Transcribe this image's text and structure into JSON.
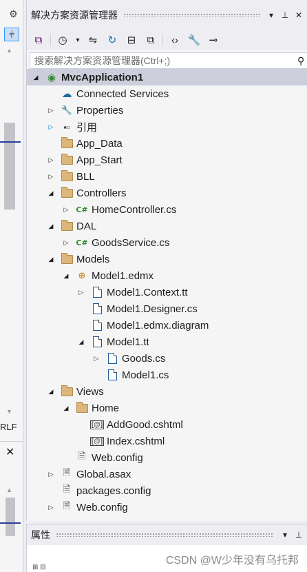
{
  "left_strip": {
    "gear_icon": "gear-icon",
    "pin_glyph": "⫩",
    "status_text": "RLF",
    "close_glyph": "✕"
  },
  "solution_explorer": {
    "title": "解决方案资源管理器",
    "title_buttons": [
      "▾",
      "📌",
      "✕"
    ],
    "toolbar": [
      {
        "name": "vs-switch-icon",
        "glyph": "⧉"
      },
      {
        "name": "history-icon",
        "glyph": "◷"
      },
      {
        "name": "dropdown-icon",
        "glyph": "▾"
      },
      {
        "name": "sync-icon",
        "glyph": "⇋"
      },
      {
        "name": "refresh-icon",
        "glyph": "↻"
      },
      {
        "name": "collapse-all-icon",
        "glyph": "⊟"
      },
      {
        "name": "show-all-files-icon",
        "glyph": "⧉"
      },
      {
        "name": "code-view-icon",
        "glyph": "‹›"
      },
      {
        "name": "properties-icon",
        "glyph": "🔧"
      },
      {
        "name": "preview-icon",
        "glyph": "⊸"
      }
    ],
    "search_placeholder": "搜索解决方案资源管理器(Ctrl+;)",
    "tree": [
      {
        "label": "MvcApplication1",
        "depth": 0,
        "expander": "expanded",
        "icon": "globe",
        "selected": true
      },
      {
        "label": "Connected Services",
        "depth": 1,
        "expander": "none",
        "icon": "cloud"
      },
      {
        "label": "Properties",
        "depth": 1,
        "expander": "collapsed",
        "icon": "wrench"
      },
      {
        "label": "引用",
        "depth": 1,
        "expander": "collapsed-blue",
        "icon": "refs"
      },
      {
        "label": "App_Data",
        "depth": 1,
        "expander": "none",
        "icon": "folder"
      },
      {
        "label": "App_Start",
        "depth": 1,
        "expander": "collapsed",
        "icon": "folder"
      },
      {
        "label": "BLL",
        "depth": 1,
        "expander": "collapsed",
        "icon": "folder"
      },
      {
        "label": "Controllers",
        "depth": 1,
        "expander": "expanded",
        "icon": "folder"
      },
      {
        "label": "HomeController.cs",
        "depth": 2,
        "expander": "collapsed",
        "icon": "csharp"
      },
      {
        "label": "DAL",
        "depth": 1,
        "expander": "expanded",
        "icon": "folder"
      },
      {
        "label": "GoodsService.cs",
        "depth": 2,
        "expander": "collapsed",
        "icon": "csharp"
      },
      {
        "label": "Models",
        "depth": 1,
        "expander": "expanded",
        "icon": "folder"
      },
      {
        "label": "Model1.edmx",
        "depth": 2,
        "expander": "expanded",
        "icon": "edmx"
      },
      {
        "label": "Model1.Context.tt",
        "depth": 3,
        "expander": "collapsed",
        "icon": "tt"
      },
      {
        "label": "Model1.Designer.cs",
        "depth": 3,
        "expander": "none",
        "icon": "tt"
      },
      {
        "label": "Model1.edmx.diagram",
        "depth": 3,
        "expander": "none",
        "icon": "tt"
      },
      {
        "label": "Model1.tt",
        "depth": 3,
        "expander": "expanded",
        "icon": "tt"
      },
      {
        "label": "Goods.cs",
        "depth": 4,
        "expander": "collapsed",
        "icon": "tt"
      },
      {
        "label": "Model1.cs",
        "depth": 4,
        "expander": "none",
        "icon": "tt"
      },
      {
        "label": "Views",
        "depth": 1,
        "expander": "expanded",
        "icon": "folder"
      },
      {
        "label": "Home",
        "depth": 2,
        "expander": "expanded",
        "icon": "folder"
      },
      {
        "label": "AddGood.cshtml",
        "depth": 3,
        "expander": "none",
        "icon": "cshtml"
      },
      {
        "label": "Index.cshtml",
        "depth": 3,
        "expander": "none",
        "icon": "cshtml"
      },
      {
        "label": "Web.config",
        "depth": 2,
        "expander": "none",
        "icon": "config"
      },
      {
        "label": "Global.asax",
        "depth": 1,
        "expander": "collapsed",
        "icon": "config"
      },
      {
        "label": "packages.config",
        "depth": 1,
        "expander": "none",
        "icon": "config"
      },
      {
        "label": "Web.config",
        "depth": 1,
        "expander": "collapsed",
        "icon": "config"
      }
    ]
  },
  "properties_panel": {
    "title": "属性",
    "title_buttons": [
      "▾",
      "📌"
    ],
    "watermark": "CSDN @W少年没有乌托邦"
  }
}
